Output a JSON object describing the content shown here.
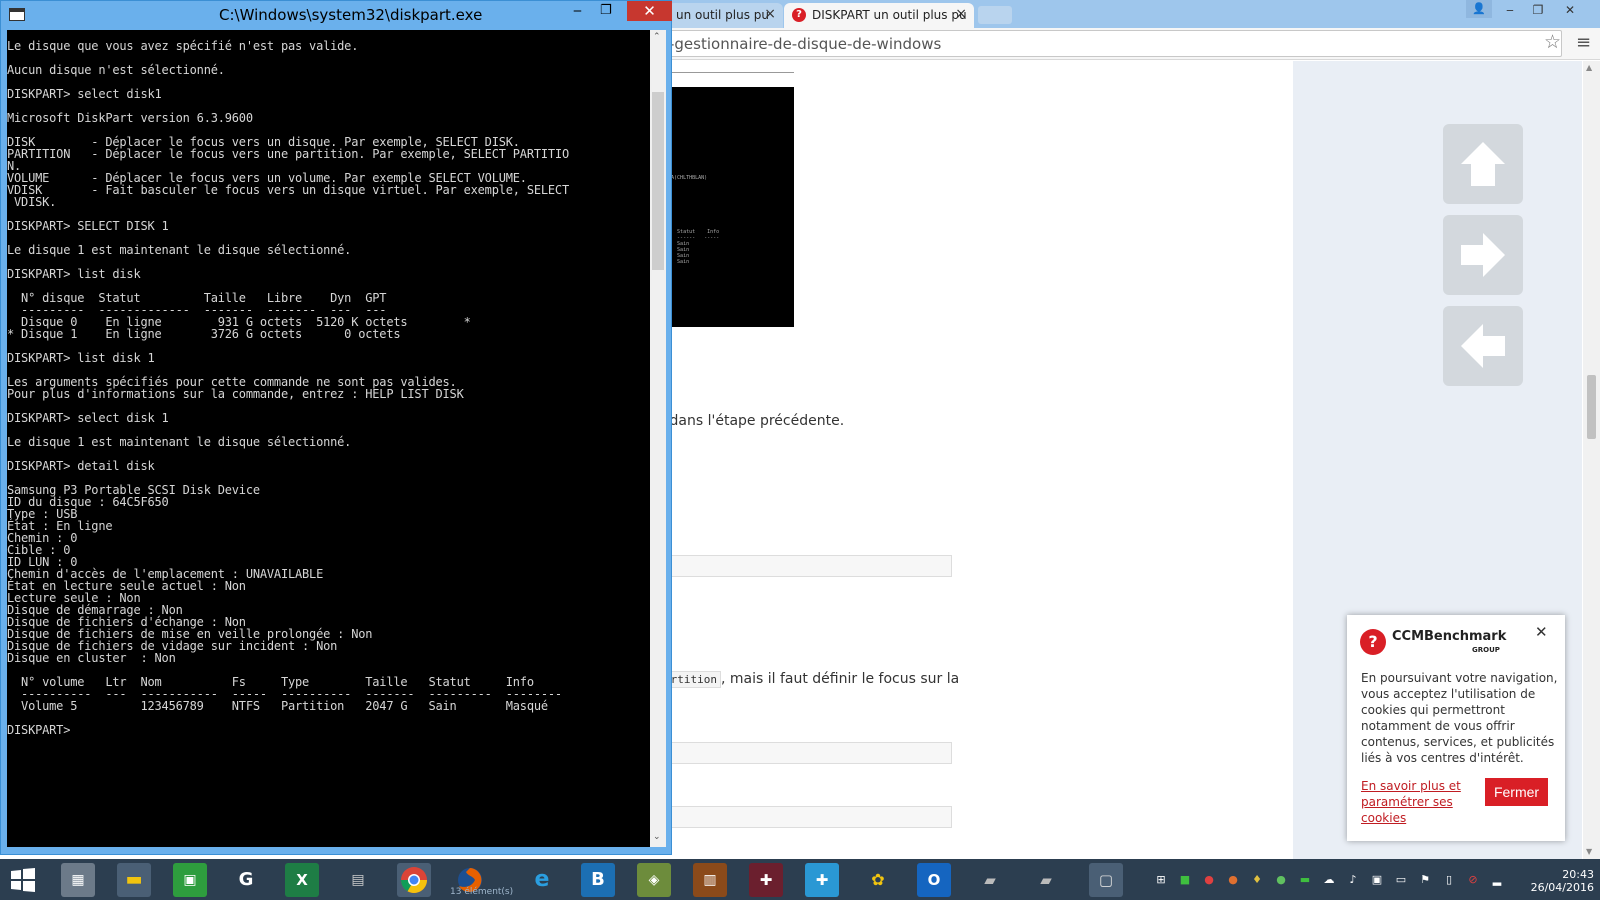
{
  "browser": {
    "tabs": [
      {
        "label": "un outil plus pu",
        "active": false
      },
      {
        "label": "DISKPART un outil plus pu",
        "active": true
      }
    ],
    "url": "-gestionnaire-de-disque-de-windows",
    "page_lines": {
      "line1": "dans l'étape précédente.",
      "line2_code": "artition",
      "line2_text": ", mais il faut définir le focus sur la",
      "input1": "."
    },
    "cookie": {
      "brand": "CCMBenchmark",
      "group": "GROUP",
      "text": "En poursuivant votre navigation, vous acceptez l'utilisation de cookies qui permettront notamment de vous offrir contenus, services, et publicités liés à vos centres d'intérêt.",
      "link": "En savoir plus et paramétrer ses cookies",
      "button": "Fermer"
    },
    "thumbnail_lines": [
      "ets",
      "ts",
      "ets",
      "ets",
      "",
      "",
      "",
      "",
      "",
      "",
      "",
      "",
      "",
      "",
      "BATA(CHLTHBLAN)",
      "",
      "",
      "",
      "",
      "",
      "",
      "",
      "",
      "lle  Statut    Info",
      "---  ------   -----",
      "5 G  Sain",
      "4 G  Sain",
      "2 G  Sain",
      "8 G  Sain"
    ]
  },
  "console": {
    "title": "C:\\Windows\\system32\\diskpart.exe",
    "lines": [
      "Le disque que vous avez spécifié n'est pas valide.",
      "",
      "Aucun disque n'est sélectionné.",
      "",
      "DISKPART> select disk1",
      "",
      "Microsoft DiskPart version 6.3.9600",
      "",
      "DISK        - Déplacer le focus vers un disque. Par exemple, SELECT DISK.",
      "PARTITION   - Déplacer le focus vers une partition. Par exemple, SELECT PARTITIO",
      "N.",
      "VOLUME      - Déplacer le focus vers un volume. Par exemple SELECT VOLUME.",
      "VDISK       - Fait basculer le focus vers un disque virtuel. Par exemple, SELECT",
      " VDISK.",
      "",
      "DISKPART> SELECT DISK 1",
      "",
      "Le disque 1 est maintenant le disque sélectionné.",
      "",
      "DISKPART> list disk",
      "",
      "  N° disque  Statut         Taille   Libre    Dyn  GPT",
      "  ---------  -------------  -------  -------  ---  ---",
      "  Disque 0    En ligne        931 G octets  5120 K octets        *",
      "* Disque 1    En ligne       3726 G octets      0 octets",
      "",
      "DISKPART> list disk 1",
      "",
      "Les arguments spécifiés pour cette commande ne sont pas valides.",
      "Pour plus d'informations sur la commande, entrez : HELP LIST DISK",
      "",
      "DISKPART> select disk 1",
      "",
      "Le disque 1 est maintenant le disque sélectionné.",
      "",
      "DISKPART> detail disk",
      "",
      "Samsung P3 Portable SCSI Disk Device",
      "ID du disque : 64C5F650",
      "Type : USB",
      "État : En ligne",
      "Chemin : 0",
      "Cible : 0",
      "ID LUN : 0",
      "Chemin d'accès de l'emplacement : UNAVAILABLE",
      "État en lecture seule actuel : Non",
      "Lecture seule : Non",
      "Disque de démarrage : Non",
      "Disque de fichiers d'échange : Non",
      "Disque de fichiers de mise en veille prolongée : Non",
      "Disque de fichiers de vidage sur incident : Non",
      "Disque en cluster  : Non",
      "",
      "  N° volume   Ltr  Nom          Fs     Type        Taille   Statut     Info",
      "  ----------  ---  -----------  -----  ----------  -------  ---------  --------",
      "  Volume 5         123456789    NTFS   Partition   2047 G   Sain       Masqué",
      "",
      "DISKPART>"
    ]
  },
  "taskbar": {
    "time": "20:43",
    "date": "26/04/2016",
    "explorer_badge": "13 élément(s)",
    "apps": [
      "start",
      "calculator",
      "explorer",
      "store",
      "google",
      "excel",
      "network",
      "chrome",
      "firefox",
      "ie",
      "bitdefender",
      "game",
      "gps",
      "puzzle",
      "addon",
      "note",
      "outlook",
      "scanner",
      "printer",
      "window"
    ]
  }
}
